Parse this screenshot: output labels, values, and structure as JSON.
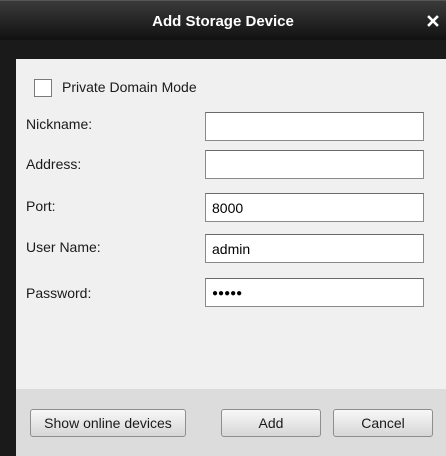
{
  "dialog": {
    "title": "Add Storage Device",
    "close_icon": "close-icon"
  },
  "form": {
    "private_domain_label": "Private Domain Mode",
    "private_domain_checked": false,
    "nickname_label": "Nickname:",
    "nickname_value": "",
    "address_label": "Address:",
    "address_value": "",
    "port_label": "Port:",
    "port_value": "8000",
    "username_label": "User Name:",
    "username_value": "admin",
    "password_label": "Password:",
    "password_masked": "●●●●●"
  },
  "buttons": {
    "show_online": "Show online devices",
    "add": "Add",
    "cancel": "Cancel"
  }
}
